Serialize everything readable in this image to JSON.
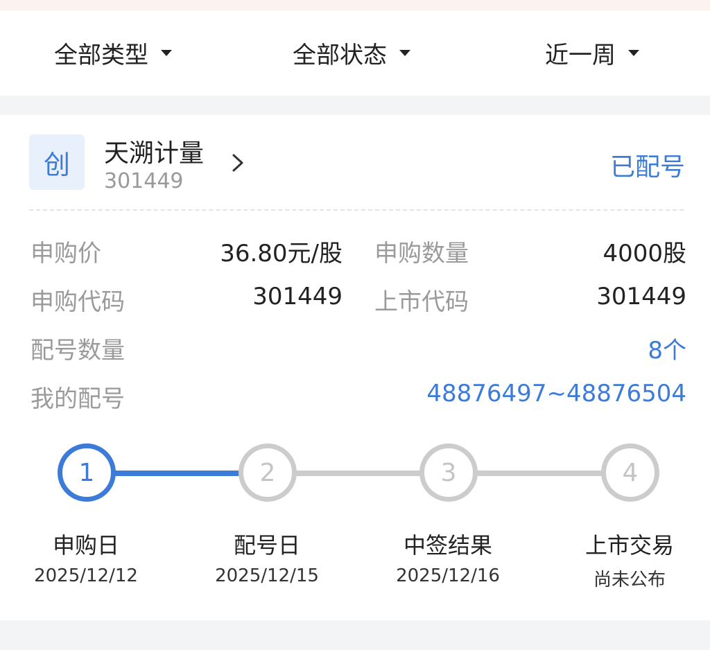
{
  "filters": [
    {
      "label": "全部类型"
    },
    {
      "label": "全部状态"
    },
    {
      "label": "近一周"
    }
  ],
  "card": {
    "board_badge": "创",
    "name": "天溯计量",
    "code": "301449",
    "status": "已配号",
    "accent_color": "#3d7bd9",
    "fields": {
      "price_label": "申购价",
      "price_value": "36.80元/股",
      "qty_label": "申购数量",
      "qty_value": "4000股",
      "sub_code_label": "申购代码",
      "sub_code_value": "301449",
      "list_code_label": "上市代码",
      "list_code_value": "301449",
      "match_count_label": "配号数量",
      "match_count_value": "8个",
      "my_match_label": "我的配号",
      "my_match_value": "48876497~48876504"
    },
    "steps": [
      {
        "num": "1",
        "label": "申购日",
        "date": "2025/12/12"
      },
      {
        "num": "2",
        "label": "配号日",
        "date": "2025/12/15"
      },
      {
        "num": "3",
        "label": "中签结果",
        "date": "2025/12/16"
      },
      {
        "num": "4",
        "label": "上市交易",
        "date": "尚未公布"
      }
    ],
    "current_step": 1
  }
}
